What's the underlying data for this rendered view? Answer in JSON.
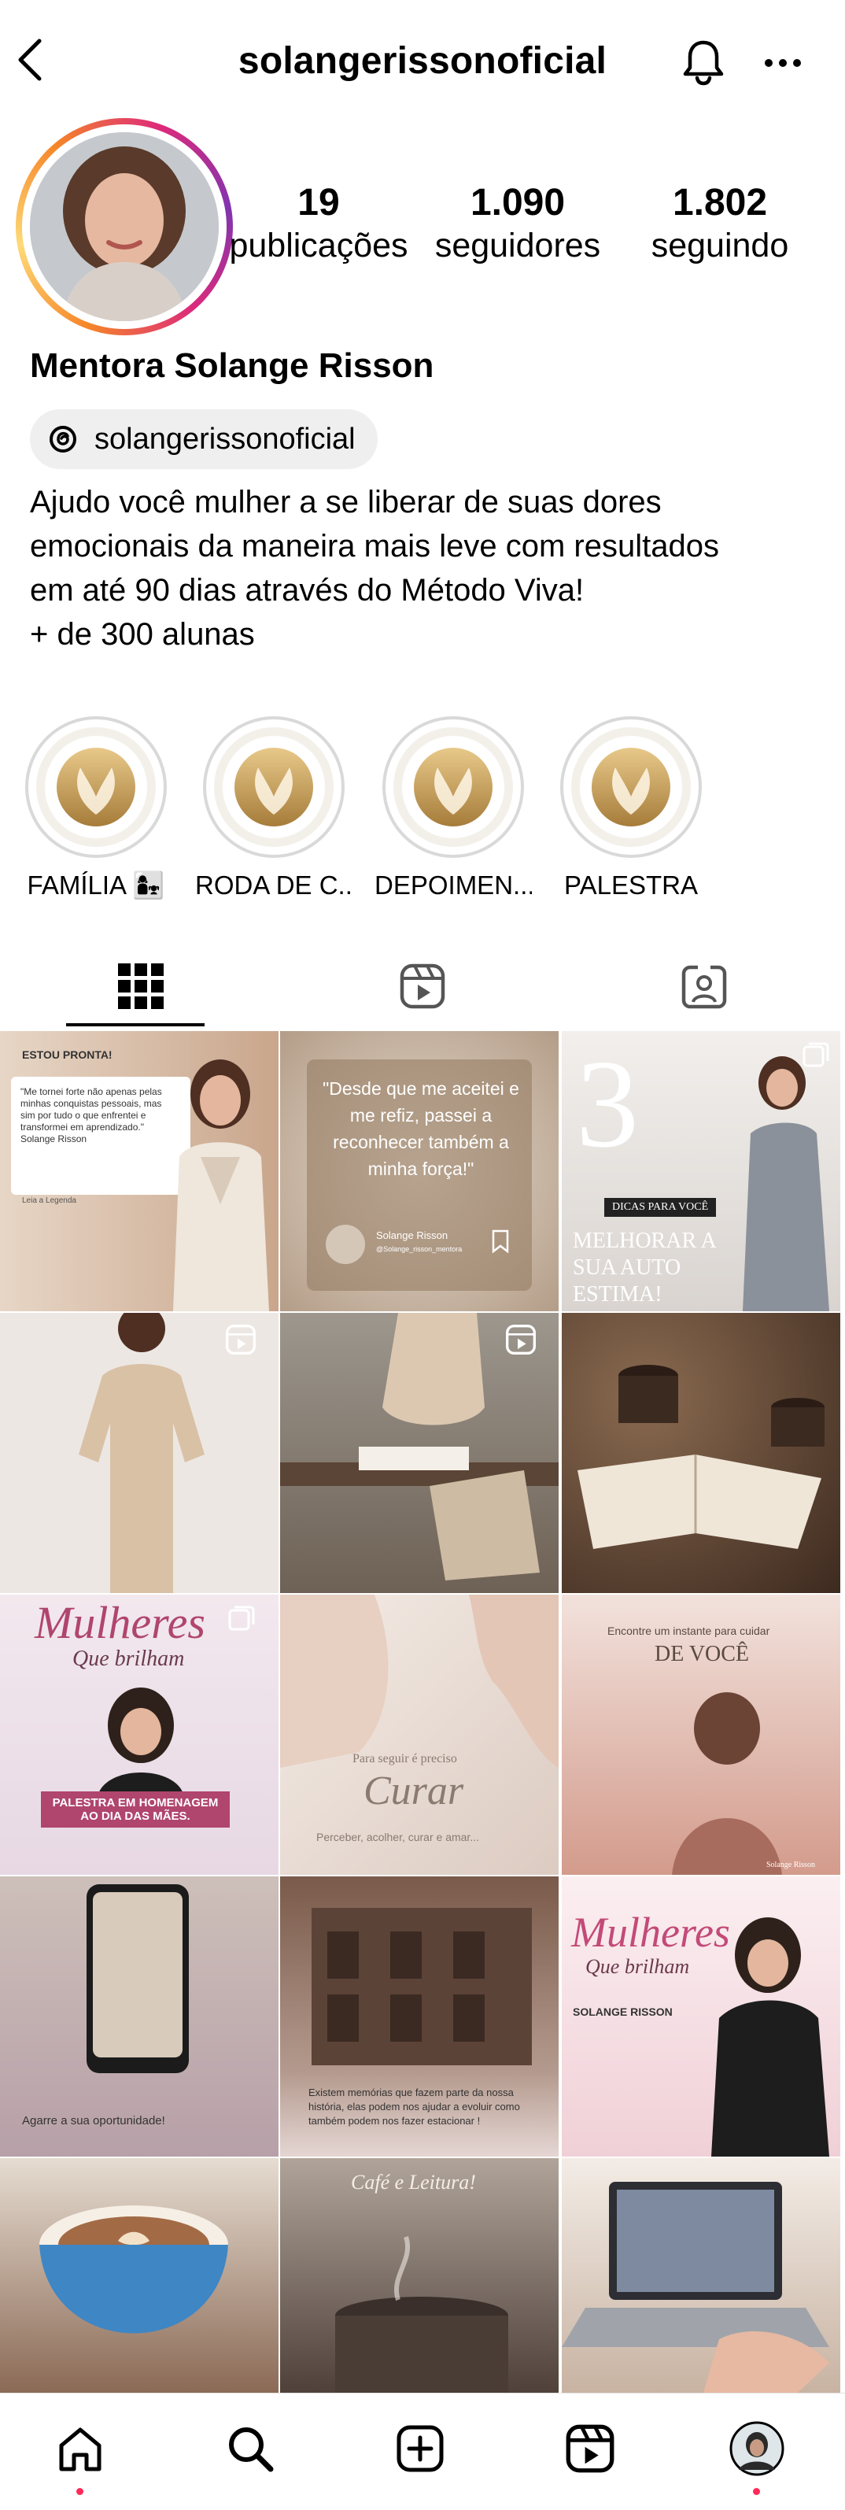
{
  "header": {
    "username": "solangerissonoficial",
    "icons": {
      "back": "chevron-left-icon",
      "notifications": "bell-icon",
      "more": "more-horizontal-icon"
    }
  },
  "profile": {
    "avatar_icon": "profile-photo",
    "ring_colors": [
      "#f58529",
      "#feda77",
      "#dd2a7b",
      "#8134af"
    ],
    "stats": [
      {
        "value": "19",
        "label": "publicações"
      },
      {
        "value": "1.090",
        "label": "seguidores"
      },
      {
        "value": "1.802",
        "label": "seguindo"
      }
    ],
    "display_name": "Mentora Solange Risson",
    "threads_handle": "solangerissonoficial",
    "bio": [
      "Ajudo você mulher a se liberar de suas dores",
      "emocionais da maneira mais leve com resultados",
      "em até 90 dias através do Método Viva!",
      "+ de 300 alunas"
    ]
  },
  "highlights": [
    {
      "label": "FAMÍLIA 👩‍👧"
    },
    {
      "label": "RODA DE C..."
    },
    {
      "label": "DEPOIMEN..."
    },
    {
      "label": "PALESTRA"
    }
  ],
  "tabs": [
    {
      "name": "grid",
      "icon": "grid-icon",
      "active": true
    },
    {
      "name": "reels",
      "icon": "reels-icon",
      "active": false
    },
    {
      "name": "tagged",
      "icon": "tagged-user-icon",
      "active": false
    }
  ],
  "posts": [
    {
      "bg": "#d8b9a1",
      "text": "ESTOU PRONTA!",
      "sub": "\"Me tornei forte não apenas pelas minhas conquistas pessoais, mas sim por tudo o que enfrentei e transformei em aprendizado.\" Solange Risson",
      "foot": "Leia a Legenda"
    },
    {
      "bg": "#c9b8a6",
      "text": "\"Desde que me aceitei e me refiz, passei a reconhecer também a minha força!\"",
      "sub": "Solange Risson",
      "foot": "@Solange_risson_mentora"
    },
    {
      "bg": "#ece9e7",
      "text": "3",
      "sub": "DICAS PARA VOCÊ",
      "foot": "MELHORAR A SUA AUTO ESTIMA!"
    },
    {
      "bg": "#ece4de",
      "text": "",
      "sub": "",
      "foot": ""
    },
    {
      "bg": "#a89a8c",
      "text": "",
      "sub": "",
      "foot": ""
    },
    {
      "bg": "#6b4a35",
      "text": "",
      "sub": "",
      "foot": ""
    },
    {
      "bg": "#efe6ea",
      "text": "Mulheres",
      "sub": "Que brilham",
      "foot": "PALESTRA EM HOMENAGEM AO DIA DAS MÃES."
    },
    {
      "bg": "#e8ddd8",
      "text": "Curar",
      "sub": "Para seguir é preciso",
      "foot": "Perceber, acolher, curar e amar..."
    },
    {
      "bg": "#d6a79c",
      "text": "DE VOCÊ",
      "sub": "Encontre um instante para cuidar",
      "foot": "Solange Risson"
    },
    {
      "bg": "#c9bcb7",
      "text": "Agarre a sua oportunidade!",
      "sub": "",
      "foot": ""
    },
    {
      "bg": "#7c6052",
      "text": "Existem memórias que fazem parte da nossa história, elas podem nos ajudar a evoluir como também podem nos fazer estacionar !",
      "sub": "",
      "foot": ""
    },
    {
      "bg": "#f4e7ea",
      "text": "Mulheres",
      "sub": "Que brilham",
      "foot": "SOLANGE RISSON"
    },
    {
      "bg": "#6d5346",
      "text": "",
      "sub": "",
      "foot": ""
    },
    {
      "bg": "#5b4b43",
      "text": "Café e Leitura!",
      "sub": "",
      "foot": ""
    },
    {
      "bg": "#d9cabd",
      "text": "",
      "sub": "",
      "foot": ""
    }
  ],
  "post_badges": [
    "",
    "",
    "carousel-icon",
    "reels-icon",
    "reels-icon",
    "",
    "carousel-icon",
    "",
    "",
    "",
    "",
    "",
    "",
    "",
    ""
  ],
  "bottom_nav": [
    {
      "name": "home",
      "icon": "home-icon"
    },
    {
      "name": "search",
      "icon": "search-icon"
    },
    {
      "name": "create",
      "icon": "create-icon"
    },
    {
      "name": "reels",
      "icon": "reels-icon"
    },
    {
      "name": "profile",
      "icon": "profile-avatar-icon"
    }
  ],
  "accent_dot_color": "#ff2a5a"
}
